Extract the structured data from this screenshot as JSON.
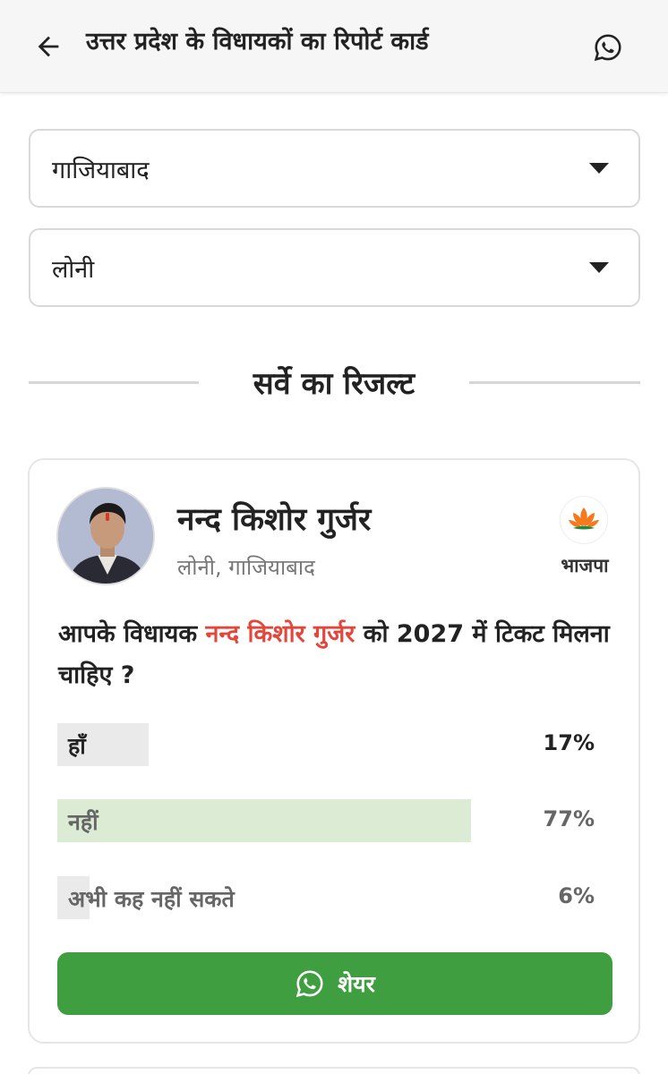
{
  "header": {
    "title": "उत्तर प्रदेश के विधायकों का रिपोर्ट कार्ड",
    "back_icon": "arrow-left-icon",
    "share_icon": "whatsapp-icon"
  },
  "filters": {
    "district": "गाजियाबाद",
    "constituency": "लोनी"
  },
  "section_title": "सर्वे का रिजल्ट",
  "mla": {
    "name": "नन्द किशोर गुर्जर",
    "location": "लोनी, गाजियाबाद",
    "party": "भाजपा",
    "party_color": "#f47a20"
  },
  "poll": {
    "question_prefix": "आपके विधायक ",
    "question_name": "नन्द किशोर गुर्जर",
    "question_suffix": " को 2027 में टिकट मिलना चाहिए ?",
    "options": [
      {
        "label": "हाँ",
        "percent_label": "17%",
        "value": 17
      },
      {
        "label": "नहीं",
        "percent_label": "77%",
        "value": 77
      },
      {
        "label": "अभी कह नहीं सकते",
        "percent_label": "6%",
        "value": 6
      }
    ]
  },
  "share": {
    "label": "शेयर",
    "color": "#3f9e3f"
  }
}
